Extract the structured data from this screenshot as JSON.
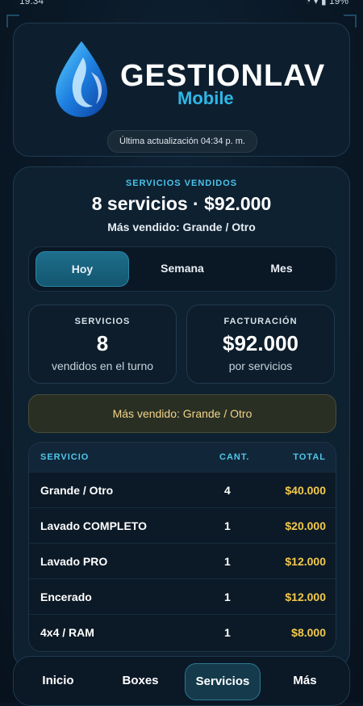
{
  "status_bar": {
    "time": "19:34",
    "icons": "◔ ▾ ▮ 19%"
  },
  "header": {
    "brand_name": "GESTIONLAV",
    "brand_sub": "Mobile",
    "update_text": "Última actualización 04:34 p. m."
  },
  "summary": {
    "label": "SERVICIOS VENDIDOS",
    "headline": "8 servicios · $92.000",
    "top_seller": "Más vendido: Grande / Otro"
  },
  "tabs": [
    {
      "label": "Hoy",
      "active": true
    },
    {
      "label": "Semana",
      "active": false
    },
    {
      "label": "Mes",
      "active": false
    }
  ],
  "stats": {
    "services": {
      "title": "SERVICIOS",
      "value": "8",
      "caption": "vendidos en el turno"
    },
    "billing": {
      "title": "FACTURACIÓN",
      "value": "$92.000",
      "caption": "por servicios"
    }
  },
  "best_banner": "Más vendido: Grande / Otro",
  "table": {
    "headers": {
      "service": "SERVICIO",
      "qty": "CANT.",
      "total": "TOTAL"
    },
    "rows": [
      {
        "service": "Grande / Otro",
        "qty": "4",
        "total": "$40.000"
      },
      {
        "service": "Lavado COMPLETO",
        "qty": "1",
        "total": "$20.000"
      },
      {
        "service": "Lavado PRO",
        "qty": "1",
        "total": "$12.000"
      },
      {
        "service": "Encerado",
        "qty": "1",
        "total": "$12.000"
      },
      {
        "service": "4x4 / RAM",
        "qty": "1",
        "total": "$8.000"
      }
    ]
  },
  "nav": {
    "inicio": "Inicio",
    "boxes": "Boxes",
    "servicios": "Servicios",
    "mas": "Más"
  },
  "colors": {
    "accent": "#2fb7e8",
    "total_gold": "#f3c94a",
    "banner_text": "#f1d489",
    "background": "#0a1826"
  }
}
